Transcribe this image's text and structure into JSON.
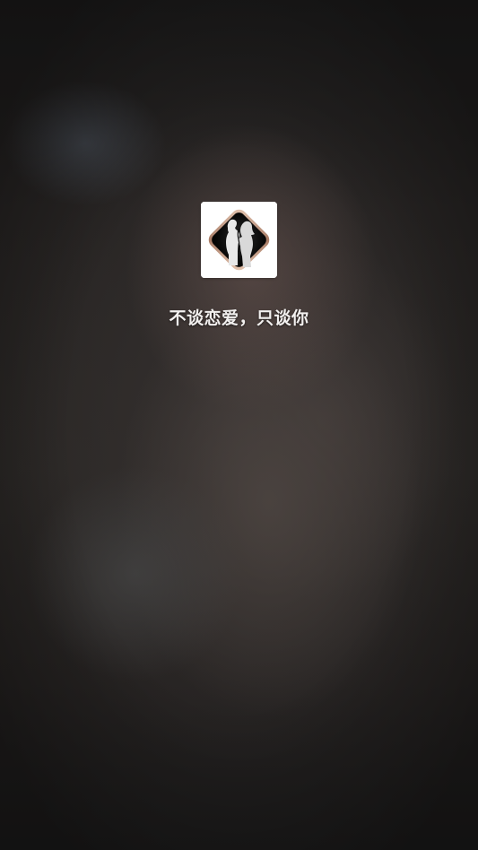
{
  "splash": {
    "slogan": "不谈恋爱，只谈你",
    "logo_icon": "couple-silhouette-icon"
  },
  "colors": {
    "background": "#22201f",
    "slogan_text": "#f2f0ef",
    "icon_frame": "#c9a38c"
  }
}
